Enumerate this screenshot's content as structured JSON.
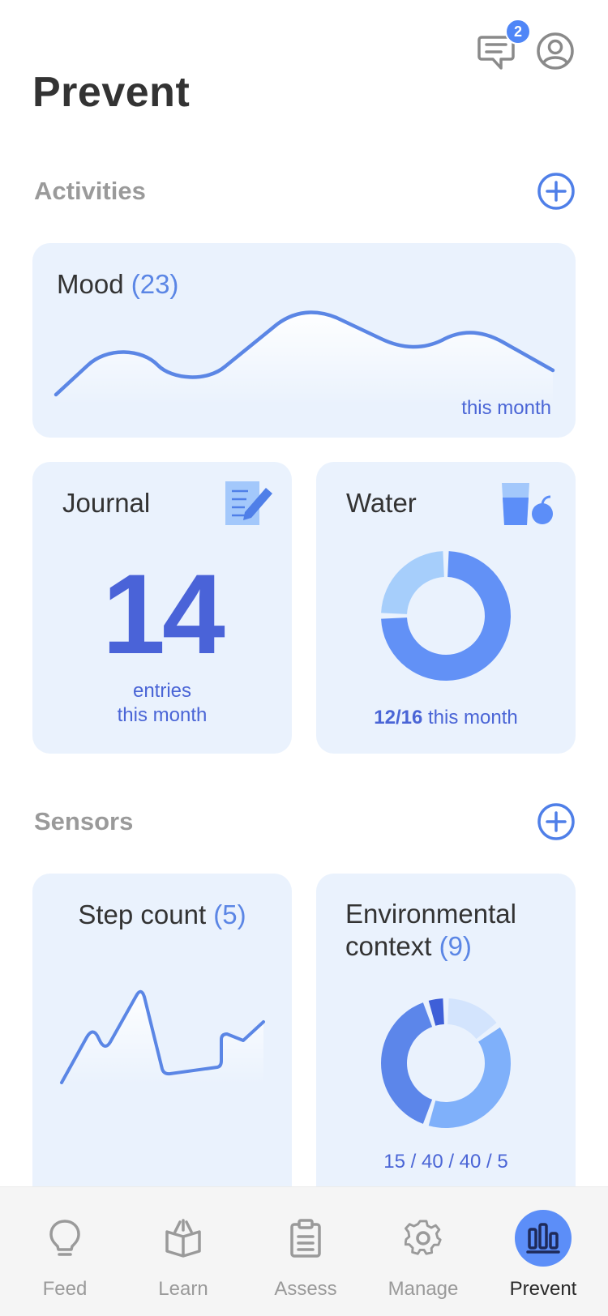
{
  "header": {
    "title": "Prevent",
    "messages_badge": "2",
    "icons": [
      "messages-icon",
      "profile-icon"
    ]
  },
  "activities": {
    "section_title": "Activities",
    "mood": {
      "title": "Mood",
      "count": "(23)",
      "period": "this month",
      "line_color": "#5b86e5"
    },
    "journal": {
      "title": "Journal",
      "value": "14",
      "caption_line1": "entries",
      "caption_line2": "this month",
      "icon": "journal-pencil-icon"
    },
    "water": {
      "title": "Water",
      "progress": "12/16",
      "period": "this month",
      "icon": "water-glass-icon",
      "consumed": 12,
      "target": 16
    }
  },
  "sensors": {
    "section_title": "Sensors",
    "steps": {
      "title": "Step count",
      "count": "(5)"
    },
    "environment": {
      "title_line1": "Environmental",
      "title_line2": "context",
      "count": "(9)",
      "breakdown": "15 / 40 / 40 / 5",
      "segments": [
        15,
        40,
        40,
        5
      ]
    }
  },
  "nav": {
    "items": [
      {
        "label": "Feed",
        "icon": "lightbulb-icon"
      },
      {
        "label": "Learn",
        "icon": "open-book-icon"
      },
      {
        "label": "Assess",
        "icon": "clipboard-icon"
      },
      {
        "label": "Manage",
        "icon": "gear-icon"
      },
      {
        "label": "Prevent",
        "icon": "bar-chart-icon"
      }
    ],
    "active": "Prevent"
  },
  "colors": {
    "accent": "#5b86e5",
    "card_bg": "#eaf2fd",
    "dark_blue": "#4a63d8",
    "light_blue": "#a3c8fb"
  }
}
